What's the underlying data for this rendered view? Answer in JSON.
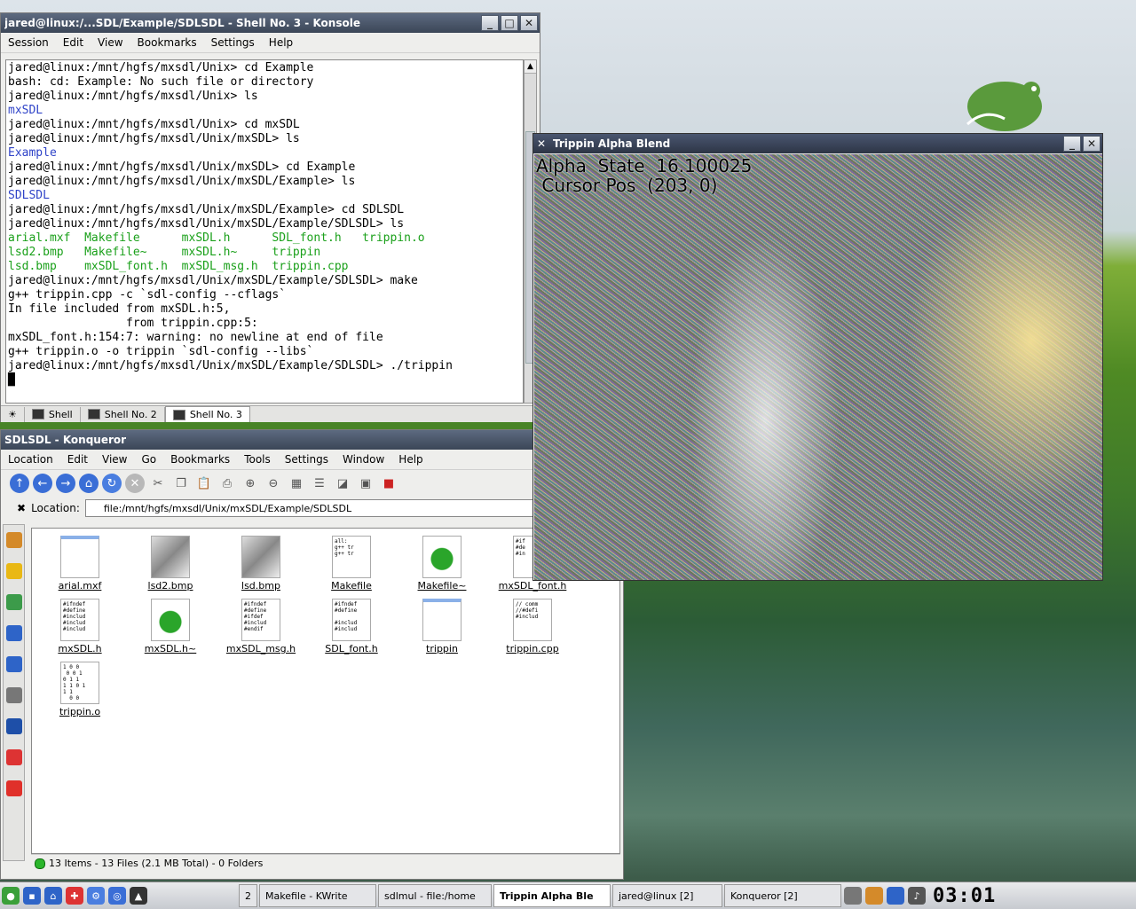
{
  "konsole": {
    "title": "jared@linux:/...SDL/Example/SDLSDL - Shell No. 3 - Konsole",
    "menu": [
      "Session",
      "Edit",
      "View",
      "Bookmarks",
      "Settings",
      "Help"
    ],
    "lines": [
      {
        "t": "jared@linux:/mnt/hgfs/mxsdl/Unix> cd Example",
        "c": ""
      },
      {
        "t": "bash: cd: Example: No such file or directory",
        "c": ""
      },
      {
        "t": "jared@linux:/mnt/hgfs/mxsdl/Unix> ls",
        "c": ""
      },
      {
        "t": "mxSDL",
        "c": "b"
      },
      {
        "t": "jared@linux:/mnt/hgfs/mxsdl/Unix> cd mxSDL",
        "c": ""
      },
      {
        "t": "jared@linux:/mnt/hgfs/mxsdl/Unix/mxSDL> ls",
        "c": ""
      },
      {
        "t": "Example",
        "c": "b"
      },
      {
        "t": "jared@linux:/mnt/hgfs/mxsdl/Unix/mxSDL> cd Example",
        "c": ""
      },
      {
        "t": "jared@linux:/mnt/hgfs/mxsdl/Unix/mxSDL/Example> ls",
        "c": ""
      },
      {
        "t": "SDLSDL",
        "c": "b"
      },
      {
        "t": "jared@linux:/mnt/hgfs/mxsdl/Unix/mxSDL/Example> cd SDLSDL",
        "c": ""
      },
      {
        "t": "jared@linux:/mnt/hgfs/mxsdl/Unix/mxSDL/Example/SDLSDL> ls",
        "c": ""
      },
      {
        "t": "arial.mxf  Makefile      mxSDL.h      SDL_font.h   trippin.o",
        "c": "g"
      },
      {
        "t": "lsd2.bmp   Makefile~     mxSDL.h~     trippin",
        "c": "g"
      },
      {
        "t": "lsd.bmp    mxSDL_font.h  mxSDL_msg.h  trippin.cpp",
        "c": "g"
      },
      {
        "t": "jared@linux:/mnt/hgfs/mxsdl/Unix/mxSDL/Example/SDLSDL> make",
        "c": ""
      },
      {
        "t": "g++ trippin.cpp -c `sdl-config --cflags`",
        "c": ""
      },
      {
        "t": "In file included from mxSDL.h:5,",
        "c": ""
      },
      {
        "t": "                 from trippin.cpp:5:",
        "c": ""
      },
      {
        "t": "mxSDL_font.h:154:7: warning: no newline at end of file",
        "c": ""
      },
      {
        "t": "g++ trippin.o -o trippin `sdl-config --libs`",
        "c": ""
      },
      {
        "t": "jared@linux:/mnt/hgfs/mxsdl/Unix/mxSDL/Example/SDLSDL> ./trippin",
        "c": ""
      },
      {
        "t": "█",
        "c": ""
      }
    ],
    "tabs": [
      "Shell",
      "Shell No. 2",
      "Shell No. 3"
    ],
    "active_tab": 2
  },
  "konqueror": {
    "title": "SDLSDL - Konqueror",
    "menu": [
      "Location",
      "Edit",
      "View",
      "Go",
      "Bookmarks",
      "Tools",
      "Settings",
      "Window",
      "Help"
    ],
    "location_label": "Location:",
    "location_value": "file:/mnt/hgfs/mxsdl/Unix/mxSDL/Example/SDLSDL",
    "files": [
      {
        "name": "arial.mxf",
        "kind": "blank"
      },
      {
        "name": "lsd2.bmp",
        "kind": "image"
      },
      {
        "name": "lsd.bmp",
        "kind": "image"
      },
      {
        "name": "Makefile",
        "kind": "text",
        "snippet": "all:\ng++ tr\ng++ tr"
      },
      {
        "name": "Makefile~",
        "kind": "backup"
      },
      {
        "name": "mxSDL_font.h",
        "kind": "text",
        "snippet": "#if\n#de\n#in"
      },
      {
        "name": "mxSDL.h",
        "kind": "text",
        "snippet": "#ifndef\n#define\n#includ\n#includ\n#includ"
      },
      {
        "name": "mxSDL.h~",
        "kind": "backup"
      },
      {
        "name": "mxSDL_msg.h",
        "kind": "text",
        "snippet": "#ifndef\n#define\n#ifdef\n#includ\n#endif"
      },
      {
        "name": "SDL_font.h",
        "kind": "text",
        "snippet": "#ifndef\n#define\n\n#includ\n#includ"
      },
      {
        "name": "trippin",
        "kind": "blank"
      },
      {
        "name": "trippin.cpp",
        "kind": "text",
        "snippet": "// comm\n//#defi\n#includ"
      },
      {
        "name": "trippin.o",
        "kind": "binary",
        "snippet": "1 0 0\n 0 0 1\n0 1 1\n1 1 0 1\n1 1\n  0 0"
      }
    ],
    "status": "13 Items - 13 Files (2.1 MB Total) - 0 Folders"
  },
  "sdl_window": {
    "title": "Trippin Alpha Blend",
    "alpha_line": "Alpha  State  16.100025",
    "cursor_line": " Cursor Pos  (203, 0)"
  },
  "taskbar": {
    "desktop_pager_label": "2",
    "tasks": [
      {
        "label": "Makefile - KWrite",
        "active": false
      },
      {
        "label": "sdlmul - file:/home",
        "active": false
      },
      {
        "label": "Trippin Alpha Ble",
        "active": true
      },
      {
        "label": "jared@linux [2]",
        "active": false
      },
      {
        "label": "Konqueror [2]",
        "active": false
      }
    ],
    "clock": "03:01"
  },
  "colors": {
    "titlebar": "#3b4657",
    "terminal_dir": "#2f43c8",
    "terminal_exec": "#1aa01a",
    "suse_green": "#5a9a3c"
  }
}
